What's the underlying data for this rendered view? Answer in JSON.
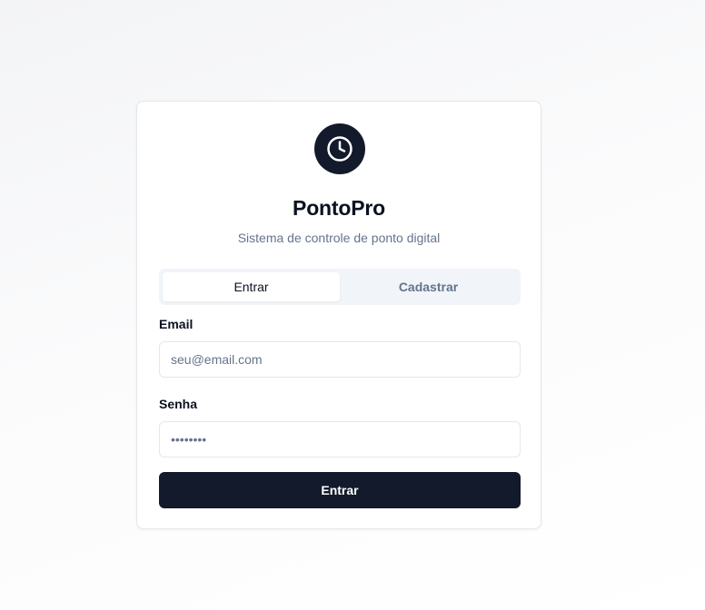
{
  "app": {
    "icon": "clock-icon",
    "title": "PontoPro",
    "subtitle": "Sistema de controle de ponto digital"
  },
  "tabs": [
    {
      "label": "Entrar",
      "active": true
    },
    {
      "label": "Cadastrar",
      "active": false
    }
  ],
  "form": {
    "email": {
      "label": "Email",
      "placeholder": "seu@email.com",
      "value": ""
    },
    "password": {
      "label": "Senha",
      "placeholder": "••••••••",
      "value": ""
    },
    "submit_label": "Entrar"
  },
  "colors": {
    "primary": "#121a2b",
    "muted_text": "#64748b",
    "border": "#e2e8f0",
    "tab_background": "#f1f5f9"
  }
}
